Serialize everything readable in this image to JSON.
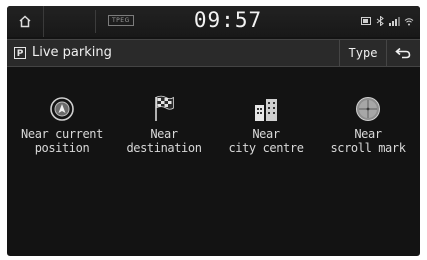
{
  "status_bar": {
    "home_icon": "home-icon",
    "tpeg_label": "TPEG",
    "time": "09:57",
    "icons": [
      "battery-icon",
      "bluetooth-icon",
      "signal-icon",
      "wifi-icon"
    ]
  },
  "title_bar": {
    "icon": "parking-icon",
    "icon_letter": "P",
    "title": "Live parking",
    "type_button": "Type",
    "back_icon": "back-arrow-icon"
  },
  "options": [
    {
      "label": "Near current\nposition",
      "icon": "current-position-icon"
    },
    {
      "label": "Near\ndestination",
      "icon": "destination-flag-icon"
    },
    {
      "label": "Near\ncity centre",
      "icon": "city-centre-icon"
    },
    {
      "label": "Near\nscroll mark",
      "icon": "scroll-mark-icon"
    }
  ]
}
